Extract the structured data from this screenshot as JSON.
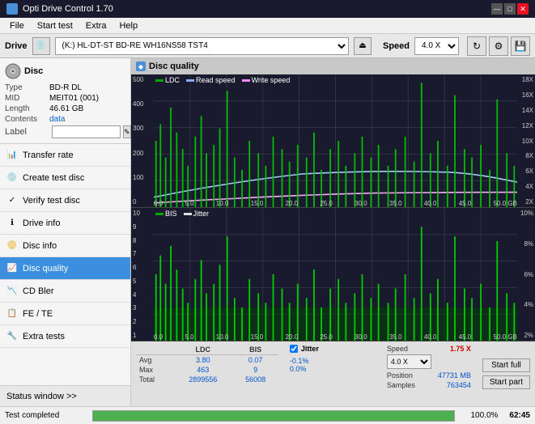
{
  "window": {
    "title": "Opti Drive Control 1.70",
    "buttons": [
      "—",
      "□",
      "✕"
    ]
  },
  "menubar": {
    "items": [
      "File",
      "Start test",
      "Extra",
      "Help"
    ]
  },
  "drivebar": {
    "label": "Drive",
    "drive_value": "(K:) HL-DT-ST BD-RE  WH16NS58 TST4",
    "speed_label": "Speed",
    "speed_value": "4.0 X",
    "speed_options": [
      "1.0 X",
      "2.0 X",
      "4.0 X",
      "8.0 X"
    ]
  },
  "disc_section": {
    "title": "Disc",
    "rows": [
      {
        "label": "Type",
        "value": "BD-R DL",
        "class": ""
      },
      {
        "label": "MID",
        "value": "MEIT01 (001)",
        "class": ""
      },
      {
        "label": "Length",
        "value": "46.61 GB",
        "class": ""
      },
      {
        "label": "Contents",
        "value": "data",
        "class": "blue"
      },
      {
        "label": "Label",
        "value": "",
        "class": ""
      }
    ]
  },
  "nav_items": [
    {
      "id": "transfer-rate",
      "label": "Transfer rate",
      "icon": "📊",
      "active": false
    },
    {
      "id": "create-test-disc",
      "label": "Create test disc",
      "icon": "💿",
      "active": false
    },
    {
      "id": "verify-test-disc",
      "label": "Verify test disc",
      "icon": "✓",
      "active": false
    },
    {
      "id": "drive-info",
      "label": "Drive info",
      "icon": "ℹ",
      "active": false
    },
    {
      "id": "disc-info",
      "label": "Disc info",
      "icon": "📀",
      "active": false
    },
    {
      "id": "disc-quality",
      "label": "Disc quality",
      "icon": "📈",
      "active": true
    },
    {
      "id": "cd-bler",
      "label": "CD Bler",
      "icon": "📉",
      "active": false
    },
    {
      "id": "fe-te",
      "label": "FE / TE",
      "icon": "📋",
      "active": false
    },
    {
      "id": "extra-tests",
      "label": "Extra tests",
      "icon": "🔧",
      "active": false
    }
  ],
  "chart": {
    "title": "Disc quality",
    "upper": {
      "legend": [
        {
          "label": "LDC",
          "color": "#00aa00"
        },
        {
          "label": "Read speed",
          "color": "#88aaff"
        },
        {
          "label": "Write speed",
          "color": "#ff88ff"
        }
      ],
      "y_axis_left": [
        "500",
        "400",
        "300",
        "200",
        "100",
        "0"
      ],
      "y_axis_right": [
        "18X",
        "16X",
        "14X",
        "12X",
        "10X",
        "8X",
        "6X",
        "4X",
        "2X"
      ],
      "x_axis": [
        "0.0",
        "5.0",
        "10.0",
        "15.0",
        "20.0",
        "25.0",
        "30.0",
        "35.0",
        "40.0",
        "45.0",
        "50.0 GB"
      ]
    },
    "lower": {
      "legend": [
        {
          "label": "BIS",
          "color": "#00aa00"
        },
        {
          "label": "Jitter",
          "color": "#dddddd"
        }
      ],
      "y_axis_left": [
        "10",
        "9",
        "8",
        "7",
        "6",
        "5",
        "4",
        "3",
        "2",
        "1"
      ],
      "y_axis_right": [
        "10%",
        "8%",
        "6%",
        "4%",
        "2%"
      ],
      "x_axis": [
        "0.0",
        "5.0",
        "10.0",
        "15.0",
        "20.0",
        "25.0",
        "30.0",
        "35.0",
        "40.0",
        "45.0",
        "50.0 GB"
      ]
    }
  },
  "stats": {
    "columns": [
      "",
      "LDC",
      "BIS"
    ],
    "rows": [
      {
        "label": "Avg",
        "ldc": "3.80",
        "bis": "0.07"
      },
      {
        "label": "Max",
        "ldc": "463",
        "bis": "9"
      },
      {
        "label": "Total",
        "ldc": "2899556",
        "bis": "56008"
      }
    ],
    "jitter": {
      "label": "Jitter",
      "checked": true,
      "values": {
        "avg": "-0.1%",
        "max": "0.0%",
        "total": ""
      }
    },
    "speed": {
      "label": "Speed",
      "value": "1.75 X"
    },
    "speed_select": "4.0 X",
    "position": {
      "label": "Position",
      "value": "47731 MB"
    },
    "samples": {
      "label": "Samples",
      "value": "763454"
    },
    "buttons": {
      "start_full": "Start full",
      "start_part": "Start part"
    }
  },
  "statusbar": {
    "text": "Test completed",
    "progress": 100,
    "percent": "100.0%",
    "time": "62:45"
  }
}
